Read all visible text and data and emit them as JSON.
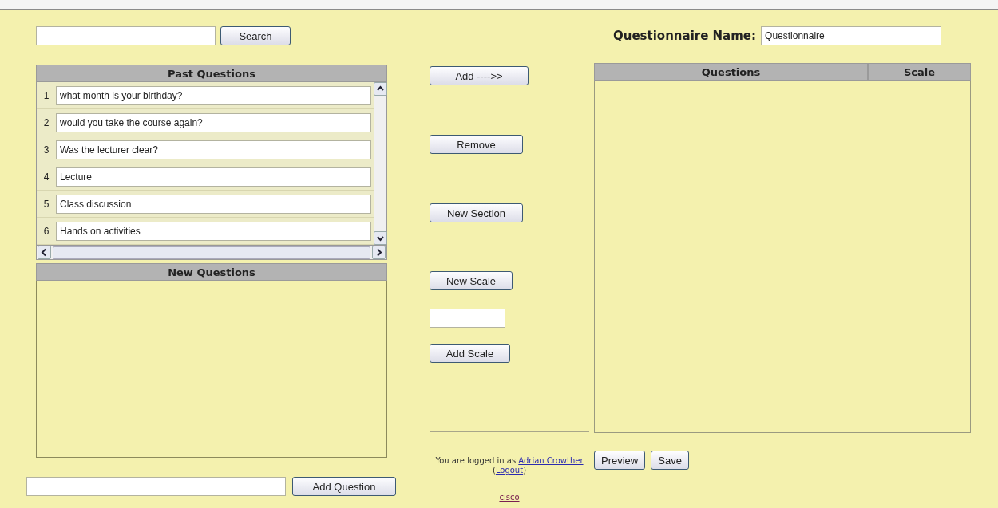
{
  "search": {
    "button": "Search"
  },
  "past_questions": {
    "title": "Past Questions",
    "rows": [
      {
        "number": "1",
        "text": "what month is your birthday?"
      },
      {
        "number": "2",
        "text": "would you take the course again?"
      },
      {
        "number": "3",
        "text": "Was the lecturer clear?"
      },
      {
        "number": "4",
        "text": "Lecture"
      },
      {
        "number": "5",
        "text": "Class discussion"
      },
      {
        "number": "6",
        "text": "Hands on activities"
      }
    ]
  },
  "new_questions": {
    "title": "New Questions"
  },
  "add_question": {
    "button": "Add Question"
  },
  "actions": {
    "add": "Add ---->>",
    "remove": "Remove",
    "new_section": "New Section",
    "new_scale": "New Scale",
    "add_scale": "Add Scale"
  },
  "footer": {
    "prefix": "You are logged in as",
    "user": "Adrian Crowther",
    "open": "(",
    "logout": "Logout",
    "close": ")",
    "site": "cisco"
  },
  "questionnaire": {
    "label": "Questionnaire Name:",
    "value": "Questionnaire",
    "columns": [
      "Questions",
      "Scale"
    ],
    "buttons": [
      "Preview",
      "Save"
    ]
  }
}
